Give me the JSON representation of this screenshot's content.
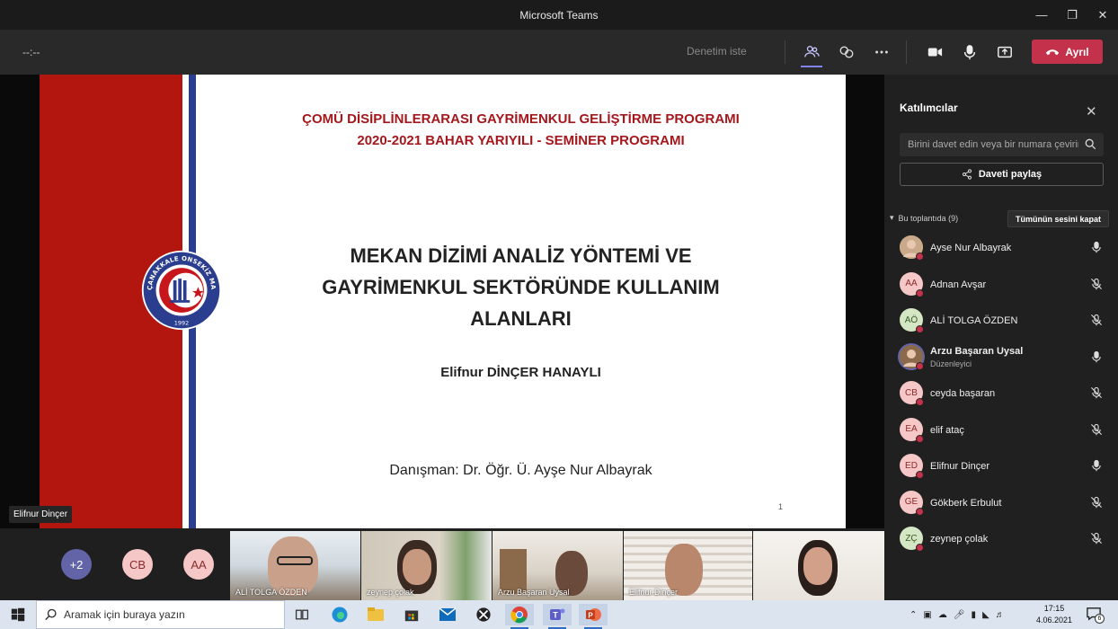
{
  "window": {
    "title": "Microsoft Teams"
  },
  "toolbar": {
    "timer": "--:--",
    "ask_control": "Denetim iste",
    "leave_label": "Ayrıl"
  },
  "slide": {
    "header_line1": "ÇOMÜ DİSİPLİNLERARASI GAYRİMENKUL GELİŞTİRME PROGRAMI",
    "header_line2": "2020-2021 BAHAR YARIYILI - SEMİNER PROGRAMI",
    "title_line1": "MEKAN DİZİMİ ANALİZ YÖNTEMİ VE",
    "title_line2": "GAYRİMENKUL SEKTÖRÜNDE KULLANIM",
    "title_line3": "ALANLARI",
    "author": "Elifnur DİNÇER HANAYLI",
    "advisor": "Danışman: Dr. Öğr. Ü. Ayşe Nur Albayrak",
    "page_number": "1",
    "logo_text": "ÇANAKKALE ONSEKİZ MART ÜNİVERSİTESİ",
    "logo_year": "1992"
  },
  "presenter_label": "Elifnur Dinçer",
  "strip": {
    "overflow": "+2",
    "avatars": [
      {
        "initials": "CB",
        "color": "#f5c7c7",
        "text": "#8a2a2a"
      },
      {
        "initials": "AA",
        "color": "#f5c7c7",
        "text": "#8a2a2a"
      }
    ],
    "videos": [
      {
        "name": "ALİ TOLGA ÖZDEN"
      },
      {
        "name": "zeynep çolak"
      },
      {
        "name": "Arzu Başaran Uysal"
      },
      {
        "name": "Elifnur Dinçer"
      },
      {
        "name": ""
      }
    ]
  },
  "panel": {
    "title": "Katılımcılar",
    "search_placeholder": "Birini davet edin veya bir numara çevirin",
    "share_invite": "Daveti paylaş",
    "in_meeting": "Bu toplantıda (9)",
    "mute_all": "Tümünün sesini kapat",
    "participants": [
      {
        "name": "Ayse Nur Albayrak",
        "initials": "",
        "photo": true,
        "color": "#c9a98a",
        "text": "#333",
        "muted": false,
        "role": ""
      },
      {
        "name": "Adnan Avşar",
        "initials": "AA",
        "photo": false,
        "color": "#f5c7c7",
        "text": "#8a2a2a",
        "muted": true,
        "role": ""
      },
      {
        "name": "ALİ TOLGA ÖZDEN",
        "initials": "AÖ",
        "photo": false,
        "color": "#d4e6c3",
        "text": "#3b5a24",
        "muted": true,
        "role": ""
      },
      {
        "name": "Arzu Başaran Uysal",
        "initials": "",
        "photo": true,
        "color": "#8a6a4a",
        "text": "#fff",
        "muted": false,
        "role": "Düzenleyici"
      },
      {
        "name": "ceyda başaran",
        "initials": "CB",
        "photo": false,
        "color": "#f5c7c7",
        "text": "#8a2a2a",
        "muted": true,
        "role": ""
      },
      {
        "name": "elif ataç",
        "initials": "EA",
        "photo": false,
        "color": "#f5c7c7",
        "text": "#8a2a2a",
        "muted": true,
        "role": ""
      },
      {
        "name": "Elifnur Dinçer",
        "initials": "ED",
        "photo": false,
        "color": "#f5c7c7",
        "text": "#8a2a2a",
        "muted": false,
        "role": ""
      },
      {
        "name": "Gökberk Erbulut",
        "initials": "GE",
        "photo": false,
        "color": "#f5c7c7",
        "text": "#8a2a2a",
        "muted": true,
        "role": ""
      },
      {
        "name": "zeynep çolak",
        "initials": "ZÇ",
        "photo": false,
        "color": "#d4e6c3",
        "text": "#3b5a24",
        "muted": true,
        "role": ""
      }
    ]
  },
  "taskbar": {
    "search_placeholder": "Aramak için buraya yazın",
    "time": "17:15",
    "date": "4.06.2021",
    "notifications": "6"
  },
  "colors": {
    "leave": "#c4314b",
    "accent": "#6264a7",
    "slide_red": "#b3150f",
    "slide_blue": "#2b3d8f"
  }
}
